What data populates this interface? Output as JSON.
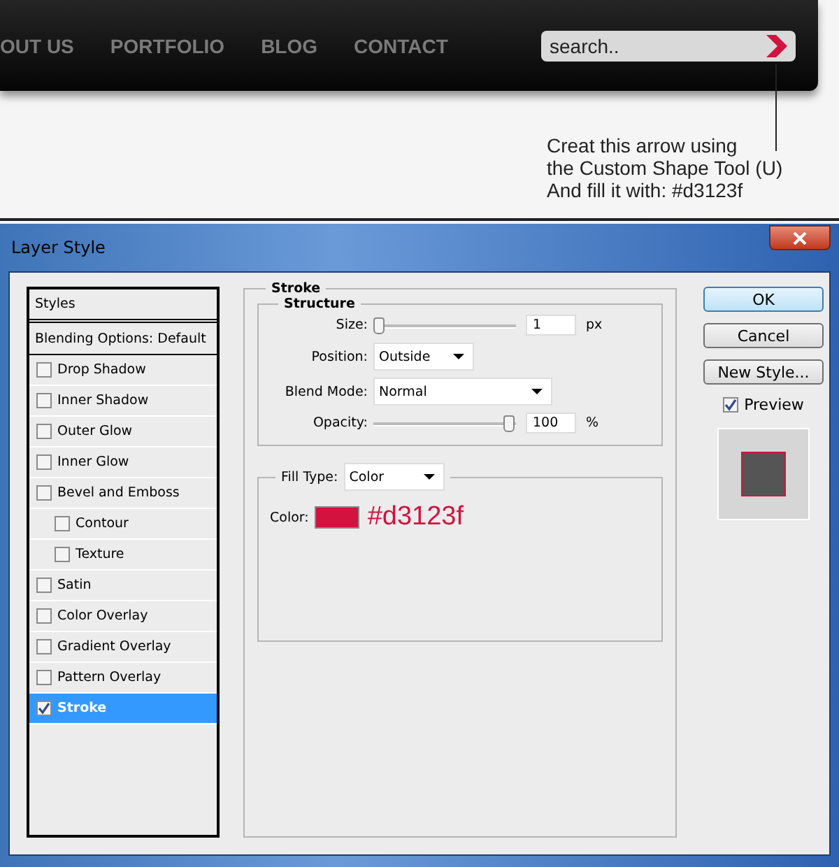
{
  "website": {
    "nav": [
      "OUT US",
      "PORTFOLIO",
      "BLOG",
      "CONTACT"
    ],
    "search": {
      "placeholder": "search.."
    }
  },
  "note": [
    "Creat this arrow using",
    "the Custom Shape Tool (U)",
    "And fill it with: #d3123f"
  ],
  "window": {
    "title": "Layer Style"
  },
  "styles": {
    "header": "Styles",
    "items": [
      {
        "label": "Blending Options: Default",
        "kind": "option",
        "selected": false
      },
      {
        "label": "Drop Shadow",
        "kind": "effect",
        "checked": false,
        "selected": false
      },
      {
        "label": "Inner Shadow",
        "kind": "effect",
        "checked": false,
        "selected": false
      },
      {
        "label": "Outer Glow",
        "kind": "effect",
        "checked": false,
        "selected": false
      },
      {
        "label": "Inner Glow",
        "kind": "effect",
        "checked": false,
        "selected": false
      },
      {
        "label": "Bevel and Emboss",
        "kind": "effect",
        "checked": false,
        "selected": false,
        "children": [
          {
            "label": "Contour",
            "kind": "effect",
            "checked": false,
            "selected": false
          },
          {
            "label": "Texture",
            "kind": "effect",
            "checked": false,
            "selected": false
          }
        ]
      },
      {
        "label": "Satin",
        "kind": "effect",
        "checked": false,
        "selected": false
      },
      {
        "label": "Color Overlay",
        "kind": "effect",
        "checked": false,
        "selected": false
      },
      {
        "label": "Gradient Overlay",
        "kind": "effect",
        "checked": false,
        "selected": false
      },
      {
        "label": "Pattern Overlay",
        "kind": "effect",
        "checked": false,
        "selected": false
      },
      {
        "label": "Stroke",
        "kind": "effect",
        "checked": true,
        "selected": true
      }
    ]
  },
  "stroke": {
    "title": "Stroke",
    "structure": {
      "title": "Structure",
      "size": {
        "label": "Size:",
        "value": "1",
        "unit": "px",
        "level": 0
      },
      "position": {
        "label": "Position:",
        "value": "Outside"
      },
      "blend_mode": {
        "label": "Blend Mode:",
        "value": "Normal"
      },
      "opacity": {
        "label": "Opacity:",
        "value": "100",
        "unit": "%",
        "level": 1
      }
    },
    "fill_type": {
      "label": "Fill Type:",
      "value": "Color"
    },
    "color": {
      "label": "Color:",
      "color": "#d3123f",
      "hex": "#d3123f"
    }
  },
  "buttons": [
    {
      "label": "OK",
      "default": true
    },
    {
      "label": "Cancel",
      "default": false
    },
    {
      "label": "New Style...",
      "default": false
    }
  ],
  "preview": {
    "label": "Preview",
    "checked": true
  }
}
